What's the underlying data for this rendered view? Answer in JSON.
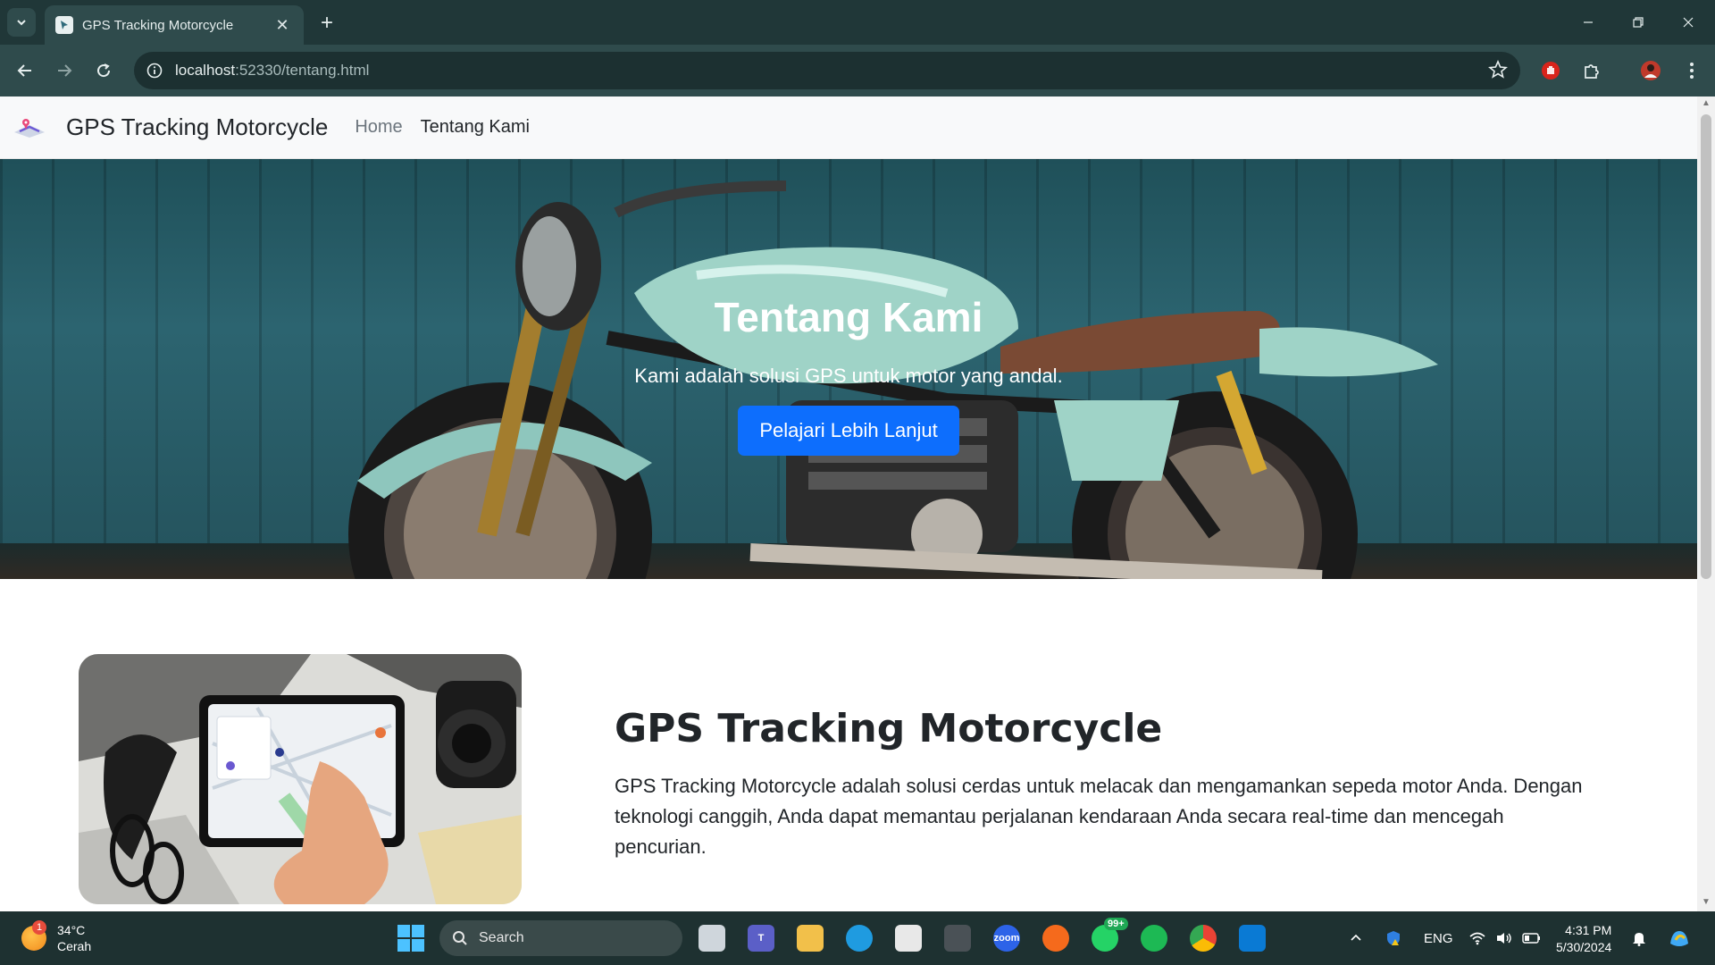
{
  "browser": {
    "tab_title": "GPS Tracking Motorcycle",
    "url_host": "localhost",
    "url_rest": ":52330/tentang.html",
    "new_tab": "+",
    "close_tab": "✕"
  },
  "navbar": {
    "brand": "GPS Tracking Motorcycle",
    "links": [
      "Home",
      "Tentang Kami"
    ]
  },
  "hero": {
    "title": "Tentang Kami",
    "subtitle": "Kami adalah solusi GPS untuk motor yang andal.",
    "button": "Pelajari Lebih Lanjut"
  },
  "about": {
    "title": "GPS Tracking Motorcycle",
    "description": "GPS Tracking Motorcycle adalah solusi cerdas untuk melacak dan mengamankan sepeda motor Anda. Dengan teknologi canggih, Anda dapat memantau perjalanan kendaraan Anda secara real-time dan mencegah pencurian."
  },
  "taskbar": {
    "weather_temp": "34°C",
    "weather_desc": "Cerah",
    "weather_badge": "1",
    "search": "Search",
    "whatsapp_badge": "99+",
    "language": "ENG",
    "time": "4:31 PM",
    "date": "5/30/2024",
    "zoom_label": "zoom"
  },
  "colors": {
    "chrome_dark": "#203738",
    "chrome_toolbar": "#2f4b4c",
    "primary_button": "#0d6efd",
    "taskbar": "#1e3131"
  }
}
